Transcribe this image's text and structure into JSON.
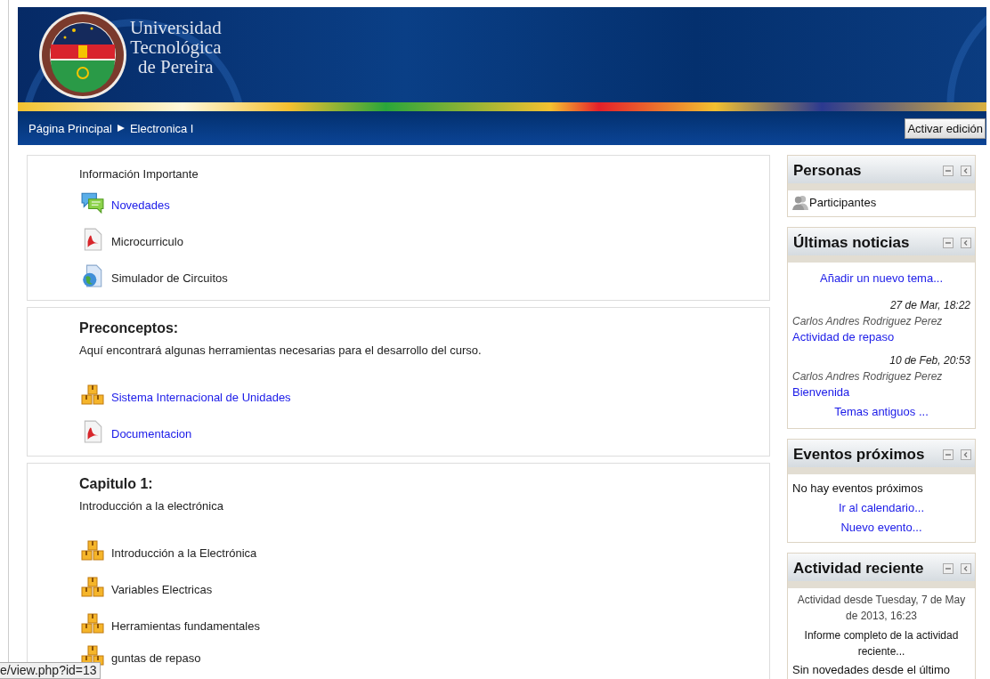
{
  "header": {
    "logo_lines": [
      "Universidad",
      "Tecnológica",
      "de Pereira"
    ]
  },
  "breadcrumb": [
    "Página Principal",
    "Electronica I"
  ],
  "edit_button": "Activar edición",
  "sections": [
    {
      "summary": "Información Importante",
      "items": [
        {
          "label": "Novedades",
          "kind": "forum",
          "linked": true
        },
        {
          "label": "Microcurriculo",
          "kind": "pdf",
          "linked": false
        },
        {
          "label": "Simulador de Circuitos",
          "kind": "web",
          "linked": false
        }
      ]
    },
    {
      "title": "Preconceptos:",
      "summary": "Aquí encontrará algunas herramientas necesarias para el desarrollo del curso.",
      "items": [
        {
          "label": "Sistema Internacional de Unidades",
          "kind": "package",
          "linked": true
        },
        {
          "label": "Documentacion",
          "kind": "pdf",
          "linked": true
        }
      ]
    },
    {
      "title": "Capitulo 1:",
      "summary": "Introducción a la electrónica",
      "items": [
        {
          "label": "Introducción a la Electrónica",
          "kind": "package",
          "linked": false
        },
        {
          "label": "Variables Electricas",
          "kind": "package",
          "linked": false
        },
        {
          "label": "Herramientas fundamentales",
          "kind": "package",
          "linked": false
        },
        {
          "label": "guntas de repaso",
          "kind": "package",
          "linked": false
        }
      ]
    }
  ],
  "blocks": [
    {
      "title": "Personas",
      "lines": [
        {
          "kind": "people",
          "text": "Participantes"
        }
      ]
    },
    {
      "title": "Últimas noticias",
      "lines": [
        {
          "kind": "center-link",
          "text": "Añadir un nuevo tema..."
        },
        {
          "kind": "date",
          "text": "27 de Mar, 18:22"
        },
        {
          "kind": "author",
          "text": "Carlos Andres Rodriguez Perez"
        },
        {
          "kind": "link",
          "text": "Actividad de repaso"
        },
        {
          "kind": "date",
          "text": "10 de Feb, 20:53"
        },
        {
          "kind": "author",
          "text": "Carlos Andres Rodriguez Perez"
        },
        {
          "kind": "link",
          "text": "Bienvenida"
        },
        {
          "kind": "center-link",
          "text": "Temas antiguos ..."
        }
      ]
    },
    {
      "title": "Eventos próximos",
      "lines": [
        {
          "kind": "text",
          "text": "No hay eventos próximos"
        },
        {
          "kind": "center-link",
          "text": "Ir al calendario..."
        },
        {
          "kind": "center-link-tight",
          "text": "Nuevo evento..."
        }
      ]
    },
    {
      "title": "Actividad reciente",
      "lines": [
        {
          "kind": "center-note",
          "text": "Actividad desde Tuesday, 7 de May de 2013, 16:23"
        },
        {
          "kind": "center-text",
          "text": "Informe completo de la actividad reciente..."
        },
        {
          "kind": "text",
          "text": "Sin novedades desde el último"
        }
      ]
    }
  ],
  "status_tooltip": "e/view.php?id=13"
}
